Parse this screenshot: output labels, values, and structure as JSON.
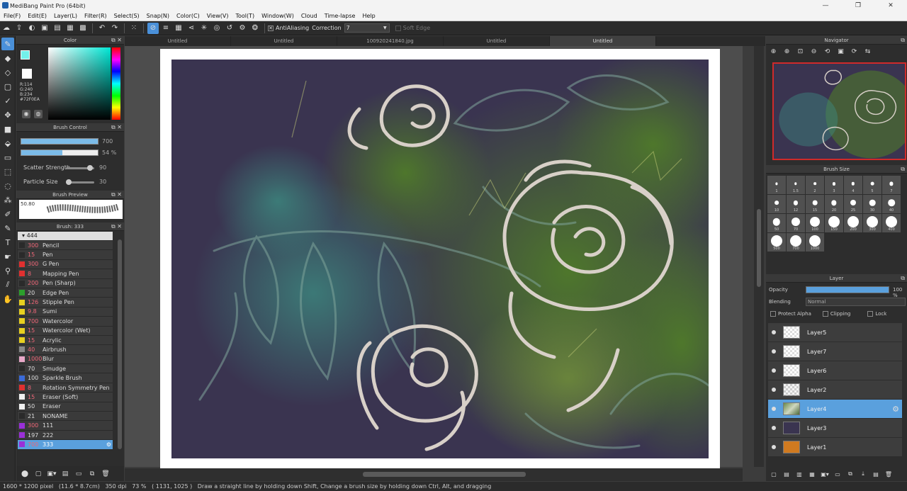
{
  "window": {
    "title": "MediBang Paint Pro (64bit)",
    "controls": [
      "—",
      "❐",
      "✕"
    ]
  },
  "menu": [
    "File(F)",
    "Edit(E)",
    "Layer(L)",
    "Filter(R)",
    "Select(S)",
    "Snap(N)",
    "Color(C)",
    "View(V)",
    "Tool(T)",
    "Window(W)",
    "Cloud",
    "Time-lapse",
    "Help"
  ],
  "toolbar": {
    "antialiasing_label": "AntiAliasing",
    "correction_label": "Correction",
    "correction_value": "7",
    "soft_edge_label": "Soft Edge"
  },
  "color_panel": {
    "title": "Color",
    "r": "R:114",
    "g": "G:240",
    "b": "B:234",
    "hex": "#72F0EA",
    "fg_color": "#72F0EA"
  },
  "brush_control": {
    "title": "Brush Control",
    "size_value": "700",
    "opacity_value": "54 %",
    "opacity_fraction": 0.54,
    "scatter_label": "Scatter Strength",
    "scatter_value": "90",
    "particle_label": "Particle Size",
    "particle_value": "30"
  },
  "brush_preview": {
    "title": "Brush Preview",
    "size": "50.80"
  },
  "brush_list": {
    "title": "Brush: 333",
    "group": "444",
    "items": [
      {
        "size": "300",
        "color": "#2a2a2a",
        "name": "Pencil"
      },
      {
        "size": "15",
        "color": "#2a2a2a",
        "name": "Pen"
      },
      {
        "size": "300",
        "color": "#e03030",
        "name": "G Pen"
      },
      {
        "size": "8",
        "color": "#e03030",
        "name": "Mapping Pen"
      },
      {
        "size": "200",
        "color": "#2a2a2a",
        "name": "Pen (Sharp)"
      },
      {
        "size": "20",
        "color": "#2ca02c",
        "name": "Edge Pen"
      },
      {
        "size": "126",
        "color": "#e8d020",
        "name": "Stipple Pen"
      },
      {
        "size": "9.8",
        "color": "#e8d020",
        "name": "Sumi"
      },
      {
        "size": "700",
        "color": "#e8d020",
        "name": "Watercolor"
      },
      {
        "size": "15",
        "color": "#e8d020",
        "name": "Watercolor (Wet)"
      },
      {
        "size": "15",
        "color": "#e8d020",
        "name": "Acrylic"
      },
      {
        "size": "40",
        "color": "#888888",
        "name": "Airbrush"
      },
      {
        "size": "1000",
        "color": "#e8a8c8",
        "name": "Blur"
      },
      {
        "size": "70",
        "color": "#2a2a2a",
        "name": "Smudge"
      },
      {
        "size": "100",
        "color": "#3a6ad8",
        "name": "Sparkle Brush"
      },
      {
        "size": "8",
        "color": "#e03030",
        "name": "Rotation Symmetry Pen"
      },
      {
        "size": "15",
        "color": "#f0f0f0",
        "name": "Eraser (Soft)"
      },
      {
        "size": "50",
        "color": "#f0f0f0",
        "name": "Eraser"
      },
      {
        "size": "21",
        "color": "#2a2a2a",
        "name": "NONAME"
      },
      {
        "size": "300",
        "color": "#9a30d8",
        "name": "111"
      },
      {
        "size": "197",
        "color": "#9a30d8",
        "name": "222"
      },
      {
        "size": "700",
        "color": "#9a30d8",
        "name": "333"
      }
    ]
  },
  "tabs": [
    "Untitled",
    "Untitled",
    "100920241840.jpg",
    "Untitled",
    "Untitled"
  ],
  "navigator": {
    "title": "Navigator"
  },
  "brush_size": {
    "title": "Brush Size",
    "sizes": [
      "1",
      "1.5",
      "2",
      "3",
      "4",
      "5",
      "7",
      "10",
      "12",
      "15",
      "20",
      "25",
      "30",
      "40",
      "50",
      "70",
      "100",
      "150",
      "200",
      "300",
      "400",
      "500",
      "700",
      "1000"
    ]
  },
  "layer_panel": {
    "title": "Layer",
    "opacity_label": "Opacity",
    "opacity_value": "100 %",
    "opacity_fraction": 1.0,
    "blending_label": "Blending",
    "blending_value": "Normal",
    "protect_alpha": "Protect Alpha",
    "clipping": "Clipping",
    "lock": "Lock",
    "layers": [
      {
        "name": "Layer5",
        "thumb": "checker"
      },
      {
        "name": "Layer7",
        "thumb": "checker"
      },
      {
        "name": "Layer6",
        "thumb": "checker"
      },
      {
        "name": "Layer2",
        "thumb": "sketch"
      },
      {
        "name": "Layer4",
        "thumb": "green"
      },
      {
        "name": "Layer3",
        "thumb": "#3a3450"
      },
      {
        "name": "Layer1",
        "thumb": "#d07a20"
      }
    ]
  },
  "status": {
    "dims": "1600 * 1200 pixel",
    "cm": "(11.6 * 8.7cm)",
    "dpi": "350 dpi",
    "zoom": "73 %",
    "coords": "( 1131, 1025 )",
    "hint": "Draw a straight line by holding down Shift, Change a brush size by holding down Ctrl, Alt, and dragging"
  }
}
